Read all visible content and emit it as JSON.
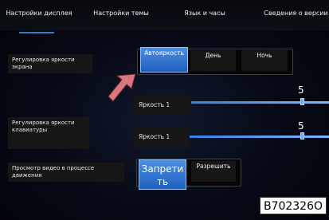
{
  "tabs": [
    {
      "label": "Настройки дисплея"
    },
    {
      "label": "Настройки темы"
    },
    {
      "label": "Язык и часы"
    },
    {
      "label": "Сведения о версии"
    }
  ],
  "screen_brightness": {
    "label": "Регулировка яркости экрана",
    "modes": [
      {
        "label": "Автояркость",
        "active": true
      },
      {
        "label": "День",
        "active": false
      },
      {
        "label": "Ночь",
        "active": false
      }
    ],
    "level_label": "Яркость 1",
    "value": "5",
    "level_fraction": 1.0
  },
  "keyboard_brightness": {
    "label": "Регулировка яркости клавиатуры",
    "level_label": "Яркость 1",
    "value": "5",
    "level_fraction": 1.0
  },
  "video_while_driving": {
    "label": "Просмотр видео в процессе движения",
    "options": [
      {
        "label": "Запретить",
        "active": true
      },
      {
        "label": "Разрешить",
        "active": false
      }
    ]
  },
  "image_code": "B702326O",
  "colors": {
    "accent": "#2f6fd0",
    "pointer_arrow": "#d9777f"
  }
}
